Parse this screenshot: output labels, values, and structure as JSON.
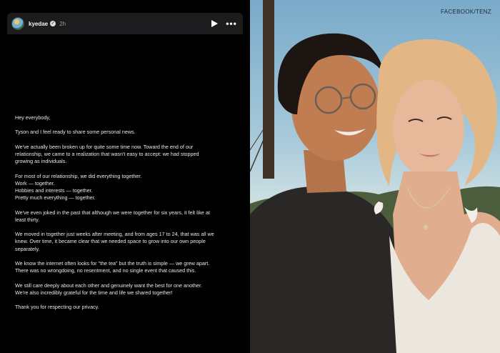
{
  "story": {
    "username": "kyedae",
    "time": "2h",
    "paragraphs": [
      [
        "Hey everybody,"
      ],
      [
        "Tyson and I feel ready to share some personal news."
      ],
      [
        "We've actually been broken up for quite some time now. Toward the end of our",
        "relationship, we came to a realization that wasn't easy to accept: we had stopped",
        "growing as individuals."
      ],
      [
        "For most of our relationship, we did everything together.",
        "Work — together.",
        "Hobbies and interests — together.",
        "Pretty much everything — together."
      ],
      [
        "We've even joked in the past that although we were together for six years, it felt like at",
        "least thirty."
      ],
      [
        "We moved in together just weeks after meeting, and from ages 17 to 24, that was all we",
        "knew. Over time, it became clear that we needed space to grow into our own people",
        "separately."
      ],
      [
        "We know the internet often looks for \"the tea\" but the truth is simple — we grew apart.",
        "There was no wrongdoing, no resentment, and no single event that caused this."
      ],
      [
        "We still care deeply about each other and genuinely want the best for one another.",
        "We're also incredibly grateful for the time and life we shared together!"
      ],
      [
        "Thank you for respecting our privacy."
      ]
    ]
  },
  "photo": {
    "credit": "FACEBOOK/TENZ"
  },
  "colors": {
    "story_bg": "#000000",
    "header_bg": "#1c1c1e",
    "text": "#e8e8e8"
  }
}
